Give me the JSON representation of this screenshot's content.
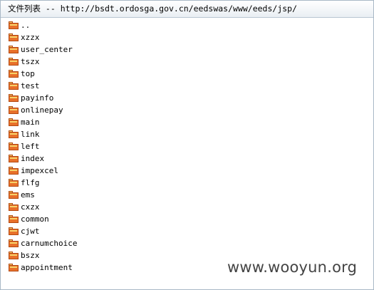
{
  "header": {
    "title": "文件列表 -- http://bsdt.ordosga.gov.cn/eedswas/www/eeds/jsp/"
  },
  "icon": {
    "name": "folder-icon",
    "color_top": "#f6d36a",
    "color_body": "#e8702a",
    "color_edge": "#b34a14"
  },
  "files": [
    {
      "name": ".."
    },
    {
      "name": "xzzx"
    },
    {
      "name": "user_center"
    },
    {
      "name": "tszx"
    },
    {
      "name": "top"
    },
    {
      "name": "test"
    },
    {
      "name": "payinfo"
    },
    {
      "name": "onlinepay"
    },
    {
      "name": "main"
    },
    {
      "name": "link"
    },
    {
      "name": "left"
    },
    {
      "name": "index"
    },
    {
      "name": "impexcel"
    },
    {
      "name": "flfg"
    },
    {
      "name": "ems"
    },
    {
      "name": "cxzx"
    },
    {
      "name": "common"
    },
    {
      "name": "cjwt"
    },
    {
      "name": "carnumchoice"
    },
    {
      "name": "bszx"
    },
    {
      "name": "appointment"
    }
  ],
  "watermark": {
    "text": "www.wooyun.org"
  }
}
